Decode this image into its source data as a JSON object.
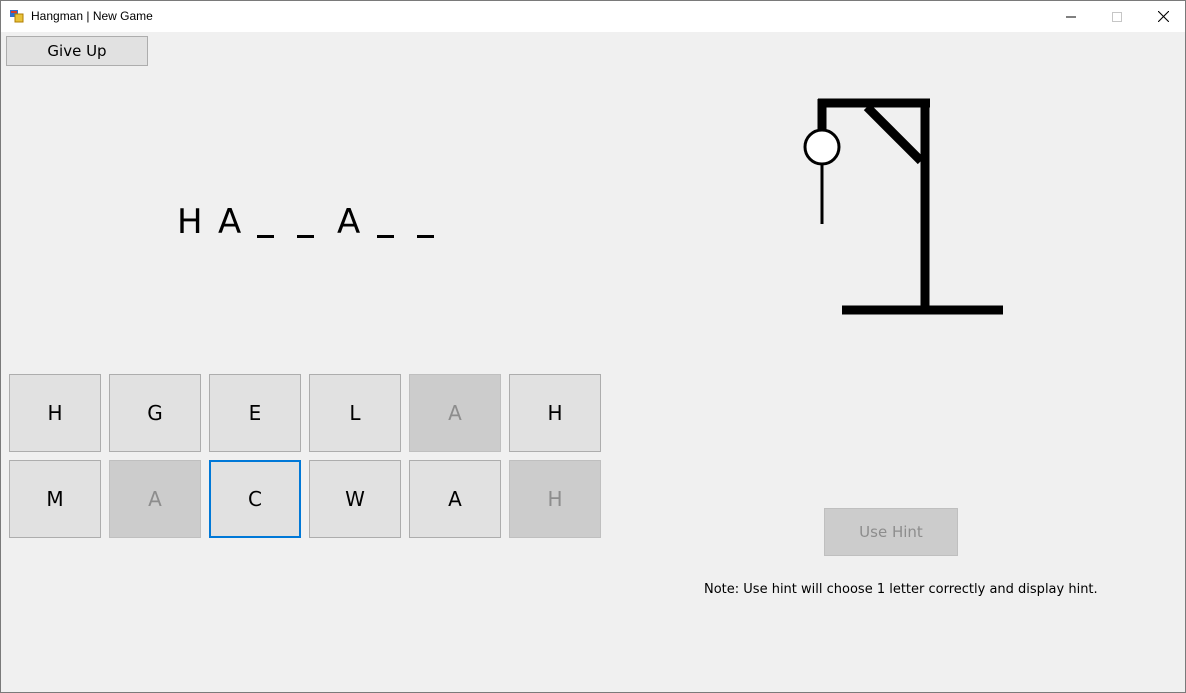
{
  "window": {
    "title": "Hangman | New Game",
    "min_glyph": "—",
    "max_glyph": "☐",
    "close_glyph": "✕"
  },
  "toolbar": {
    "give_up_label": "Give Up"
  },
  "word": {
    "slots": [
      "H",
      "A",
      "",
      "",
      "A",
      "",
      ""
    ]
  },
  "keyboard": {
    "keys": [
      {
        "letter": "H",
        "used": false
      },
      {
        "letter": "G",
        "used": false
      },
      {
        "letter": "E",
        "used": false
      },
      {
        "letter": "L",
        "used": false
      },
      {
        "letter": "A",
        "used": true
      },
      {
        "letter": "H",
        "used": false
      },
      {
        "letter": "M",
        "used": false
      },
      {
        "letter": "A",
        "used": true
      },
      {
        "letter": "C",
        "used": false
      },
      {
        "letter": "W",
        "used": false
      },
      {
        "letter": "A",
        "used": false
      },
      {
        "letter": "H",
        "used": true
      }
    ]
  },
  "hint": {
    "button_label": "Use Hint",
    "note": "Note:  Use hint will choose 1 letter correctly and display hint."
  },
  "colors": {
    "focus": "#0078d7",
    "disabled_text": "#8d8d8d"
  }
}
